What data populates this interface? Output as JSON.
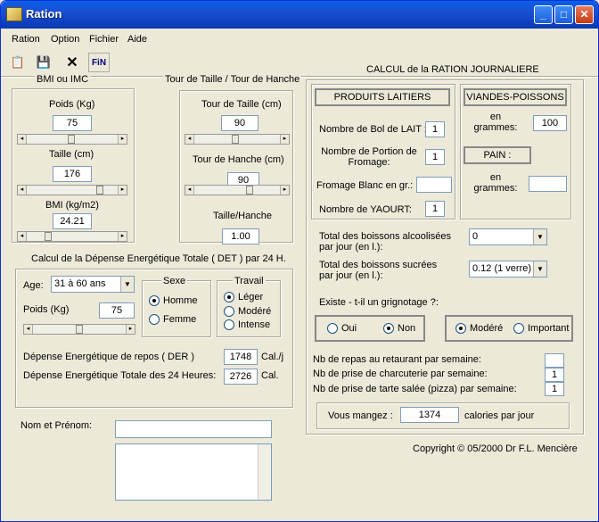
{
  "title": "Ration",
  "menu": [
    "Ration",
    "Option",
    "Fichier",
    "Aide"
  ],
  "toolbar": {
    "fin_label": "FiN"
  },
  "bmi": {
    "group_title": "BMI ou IMC",
    "poids_label": "Poids (Kg)",
    "poids": "75",
    "taille_label": "Taille (cm)",
    "taille": "176",
    "bmi_label": "BMI (kg/m2)",
    "bmi": "24.21"
  },
  "tour": {
    "group_title": "Tour de Taille / Tour de Hanche",
    "taille_label": "Tour de Taille (cm)",
    "taille": "90",
    "hanche_label": "Tour de Hanche (cm)",
    "hanche": "90",
    "ratio_label": "Taille/Hanche",
    "ratio": "1.00"
  },
  "det": {
    "title": "Calcul de la Dépense Energétique Totale ( DET ) par 24 H.",
    "age_label": "Age:",
    "age": "31 à 60 ans",
    "poids_label": "Poids (Kg)",
    "poids": "75",
    "sexe_title": "Sexe",
    "homme": "Homme",
    "femme": "Femme",
    "travail_title": "Travail",
    "leger": "Léger",
    "modere": "Modéré",
    "intense": "Intense",
    "der_label": "Dépense Energétique de repos ( DER )",
    "der": "1748",
    "der_unit": "Cal./j",
    "det_label": "Dépense Energétique Totale des 24 Heures:",
    "det": "2726",
    "det_unit": "Cal."
  },
  "nom": {
    "label": "Nom et Prénom:",
    "value": "",
    "notes": ""
  },
  "ration": {
    "title": "CALCUL de la RATION JOURNALIERE",
    "laitiers_title": "PRODUITS LAITIERS",
    "bol_label": "Nombre de Bol de LAIT :",
    "bol": "1",
    "fromage_label": "Nombre de Portion de Fromage:",
    "fromage": "1",
    "fromage_blanc_label": "Fromage Blanc en gr.:",
    "fromage_blanc": "",
    "yaourt_label": "Nombre de YAOURT:",
    "yaourt": "1",
    "viandes_title": "VIANDES-POISSONS",
    "viandes_unit": "en grammes:",
    "viandes": "100",
    "pain_title": "PAIN :",
    "pain_unit": "en grammes:",
    "pain": "",
    "alcool_label": "Total des boissons alcoolisées par jour (en l.):",
    "alcool": "0",
    "sucre_label": "Total des boissons sucrées par jour (en l.):",
    "sucre": "0.12 (1 verre)",
    "grignotage_label": "Existe - t-il un grignotage ?:",
    "oui": "Oui",
    "non": "Non",
    "modere": "Modéré",
    "important": "Important",
    "restaurant_label": "Nb de repas au retaurant par semaine:",
    "restaurant": "",
    "charcuterie_label": "Nb de prise de charcuterie par semaine:",
    "charcuterie": "1",
    "tarte_label": "Nb de prise de tarte salée (pizza) par semaine:",
    "tarte": "1",
    "mangez_label": "Vous mangez :",
    "calories": "1374",
    "calories_unit": "calories par jour"
  },
  "copyright": "Copyright © 05/2000 Dr F.L. Mencière"
}
